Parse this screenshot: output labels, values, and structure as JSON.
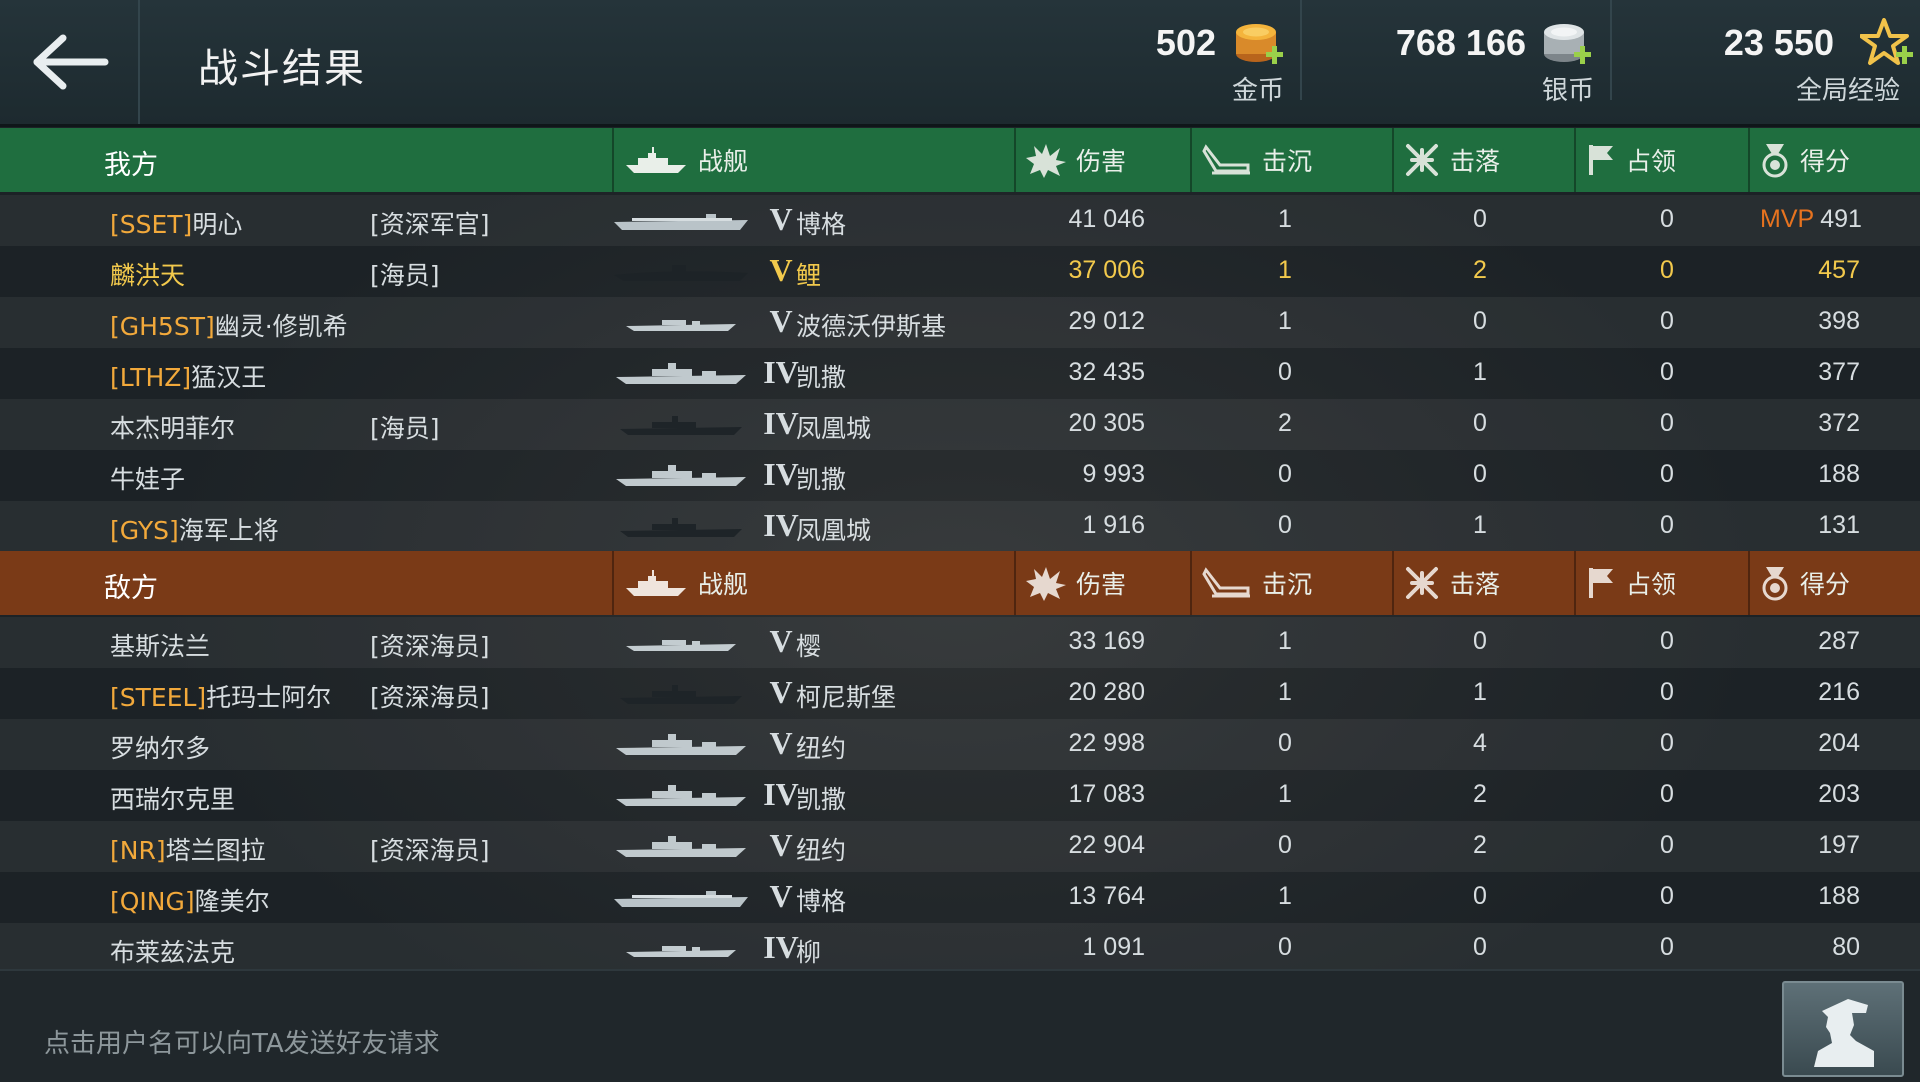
{
  "header": {
    "title": "战斗结果",
    "currencies": [
      {
        "value": "502",
        "label": "金币",
        "icon": "gold-coin-icon"
      },
      {
        "value": "768 166",
        "label": "银币",
        "icon": "silver-coin-icon"
      },
      {
        "value": "23 550",
        "label": "全局经验",
        "icon": "star-xp-icon"
      }
    ]
  },
  "columns": {
    "ship": "战舰",
    "damage": "伤害",
    "sunk": "击沉",
    "downed": "击落",
    "capture": "占领",
    "score": "得分"
  },
  "ours": {
    "team_label": "我方",
    "rows": [
      {
        "clan": "[SSET]",
        "name": "明心",
        "rank": "[资深军官]",
        "tier": "V",
        "ship": "博格",
        "damage": "41 046",
        "sunk": "1",
        "downed": "0",
        "capture": "0",
        "mvp": "MVP",
        "score": "491",
        "silhouette": "carrier"
      },
      {
        "clan": "",
        "name": "麟洪天",
        "rank": "[海员]",
        "tier": "V",
        "ship": "鲤",
        "damage": "37 006",
        "sunk": "1",
        "downed": "2",
        "capture": "0",
        "mvp": "",
        "score": "457",
        "silhouette": "sub",
        "me": true
      },
      {
        "clan": "[GH5ST]",
        "name": "幽灵·修凯希",
        "rank": "",
        "tier": "V",
        "ship": "波德沃伊斯基",
        "damage": "29 012",
        "sunk": "1",
        "downed": "0",
        "capture": "0",
        "mvp": "",
        "score": "398",
        "silhouette": "destroyer"
      },
      {
        "clan": "[LTHZ]",
        "name": "猛汉王",
        "rank": "",
        "tier": "IV",
        "ship": "凯撒",
        "damage": "32 435",
        "sunk": "0",
        "downed": "1",
        "capture": "0",
        "mvp": "",
        "score": "377",
        "silhouette": "battleship"
      },
      {
        "clan": "",
        "name": "本杰明菲尔",
        "rank": "[海员]",
        "tier": "IV",
        "ship": "凤凰城",
        "damage": "20 305",
        "sunk": "2",
        "downed": "0",
        "capture": "0",
        "mvp": "",
        "score": "372",
        "silhouette": "cruiser"
      },
      {
        "clan": "",
        "name": "牛娃子",
        "rank": "",
        "tier": "IV",
        "ship": "凯撒",
        "damage": "9 993",
        "sunk": "0",
        "downed": "0",
        "capture": "0",
        "mvp": "",
        "score": "188",
        "silhouette": "battleship"
      },
      {
        "clan": "[GYS]",
        "name": "海军上将",
        "rank": "",
        "tier": "IV",
        "ship": "凤凰城",
        "damage": "1 916",
        "sunk": "0",
        "downed": "1",
        "capture": "0",
        "mvp": "",
        "score": "131",
        "silhouette": "cruiser"
      }
    ]
  },
  "enemy": {
    "team_label": "敌方",
    "rows": [
      {
        "clan": "",
        "name": "基斯法兰",
        "rank": "[资深海员]",
        "tier": "V",
        "ship": "樱",
        "damage": "33 169",
        "sunk": "1",
        "downed": "0",
        "capture": "0",
        "mvp": "",
        "score": "287",
        "silhouette": "destroyer"
      },
      {
        "clan": "[STEEL]",
        "name": "托玛士阿尔",
        "rank": "[资深海员]",
        "tier": "V",
        "ship": "柯尼斯堡",
        "damage": "20 280",
        "sunk": "1",
        "downed": "1",
        "capture": "0",
        "mvp": "",
        "score": "216",
        "silhouette": "cruiser"
      },
      {
        "clan": "",
        "name": "罗纳尔多",
        "rank": "",
        "tier": "V",
        "ship": "纽约",
        "damage": "22 998",
        "sunk": "0",
        "downed": "4",
        "capture": "0",
        "mvp": "",
        "score": "204",
        "silhouette": "battleship"
      },
      {
        "clan": "",
        "name": "西瑞尔克里",
        "rank": "",
        "tier": "IV",
        "ship": "凯撒",
        "damage": "17 083",
        "sunk": "1",
        "downed": "2",
        "capture": "0",
        "mvp": "",
        "score": "203",
        "silhouette": "battleship"
      },
      {
        "clan": "[NR]",
        "name": "塔兰图拉",
        "rank": "[资深海员]",
        "tier": "V",
        "ship": "纽约",
        "damage": "22 904",
        "sunk": "0",
        "downed": "2",
        "capture": "0",
        "mvp": "",
        "score": "197",
        "silhouette": "battleship"
      },
      {
        "clan": "[QING]",
        "name": "隆美尔",
        "rank": "",
        "tier": "V",
        "ship": "博格",
        "damage": "13 764",
        "sunk": "1",
        "downed": "0",
        "capture": "0",
        "mvp": "",
        "score": "188",
        "silhouette": "carrier"
      },
      {
        "clan": "",
        "name": "布莱兹法克",
        "rank": "",
        "tier": "IV",
        "ship": "柳",
        "damage": "1 091",
        "sunk": "0",
        "downed": "0",
        "capture": "0",
        "mvp": "",
        "score": "80",
        "silhouette": "destroyer"
      }
    ]
  },
  "footer": {
    "hint": "点击用户名可以向TA发送好友请求",
    "captain_icon": "captain-silhouette-icon"
  },
  "colors": {
    "ours_header": "#1f6e3f",
    "enemy_header": "#7a3a17",
    "clan_tag": "#f2a93b",
    "highlight": "#f2c94c",
    "mvp": "#e7731f"
  }
}
